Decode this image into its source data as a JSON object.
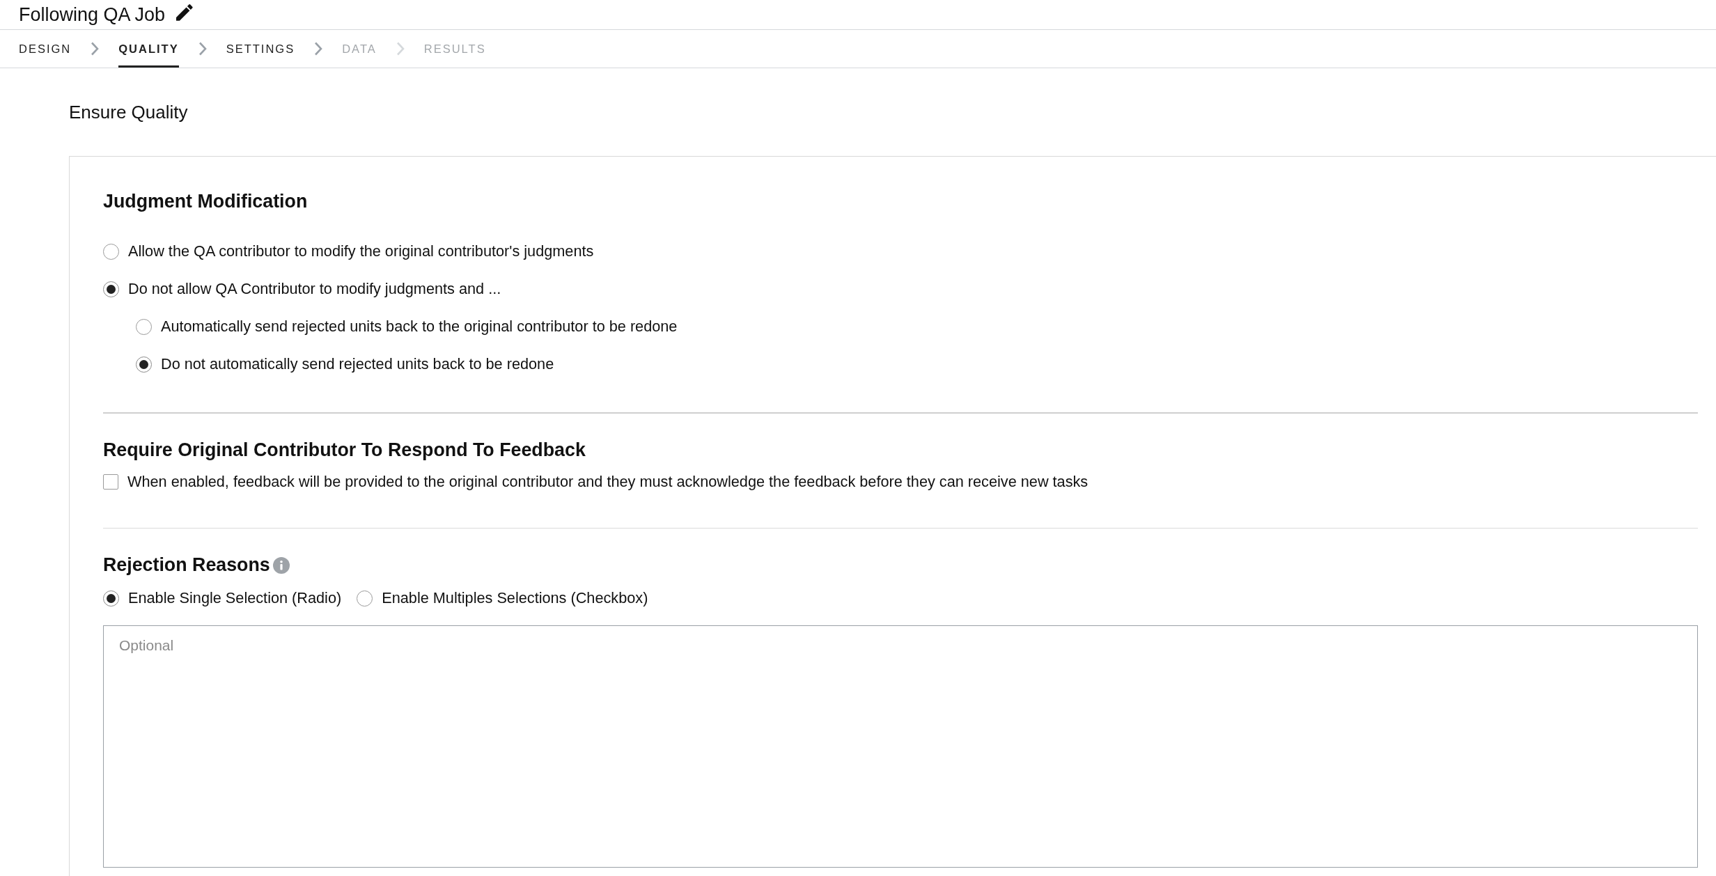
{
  "header": {
    "title": "Following QA Job"
  },
  "steps": [
    {
      "label": "DESIGN",
      "selected": false,
      "disabled": false
    },
    {
      "label": "QUALITY",
      "selected": true,
      "disabled": false
    },
    {
      "label": "SETTINGS",
      "selected": false,
      "disabled": false
    },
    {
      "label": "DATA",
      "selected": false,
      "disabled": true
    },
    {
      "label": "RESULTS",
      "selected": false,
      "disabled": true
    }
  ],
  "page_title": "Ensure Quality",
  "sections": [
    {
      "kind": "radio_list",
      "title": "Judgment Modification",
      "options": [
        {
          "label": "Allow the QA contributor to modify the original contributor's judgments",
          "selected": false
        },
        {
          "label": "Do not allow QA Contributor to modify judgments and ...",
          "selected": true,
          "children": [
            {
              "label": "Automatically send rejected units back to the original contributor to be redone",
              "selected": false
            },
            {
              "label": "Do not automatically send rejected units back to be redone",
              "selected": true
            }
          ]
        }
      ]
    },
    {
      "kind": "checkbox",
      "title": "Require Original Contributor To Respond To Feedback",
      "checkbox": {
        "label": "When enabled, feedback will be provided to the original contributor and they must acknowledge the feedback before they can receive new tasks",
        "checked": false
      }
    },
    {
      "kind": "reasons",
      "title": "Rejection Reasons",
      "options": [
        {
          "label": "Enable Single Selection (Radio)",
          "selected": true
        },
        {
          "label": "Enable Multiples Selections (Checkbox)",
          "selected": false
        }
      ],
      "textarea": {
        "placeholder": "Optional"
      }
    }
  ]
}
